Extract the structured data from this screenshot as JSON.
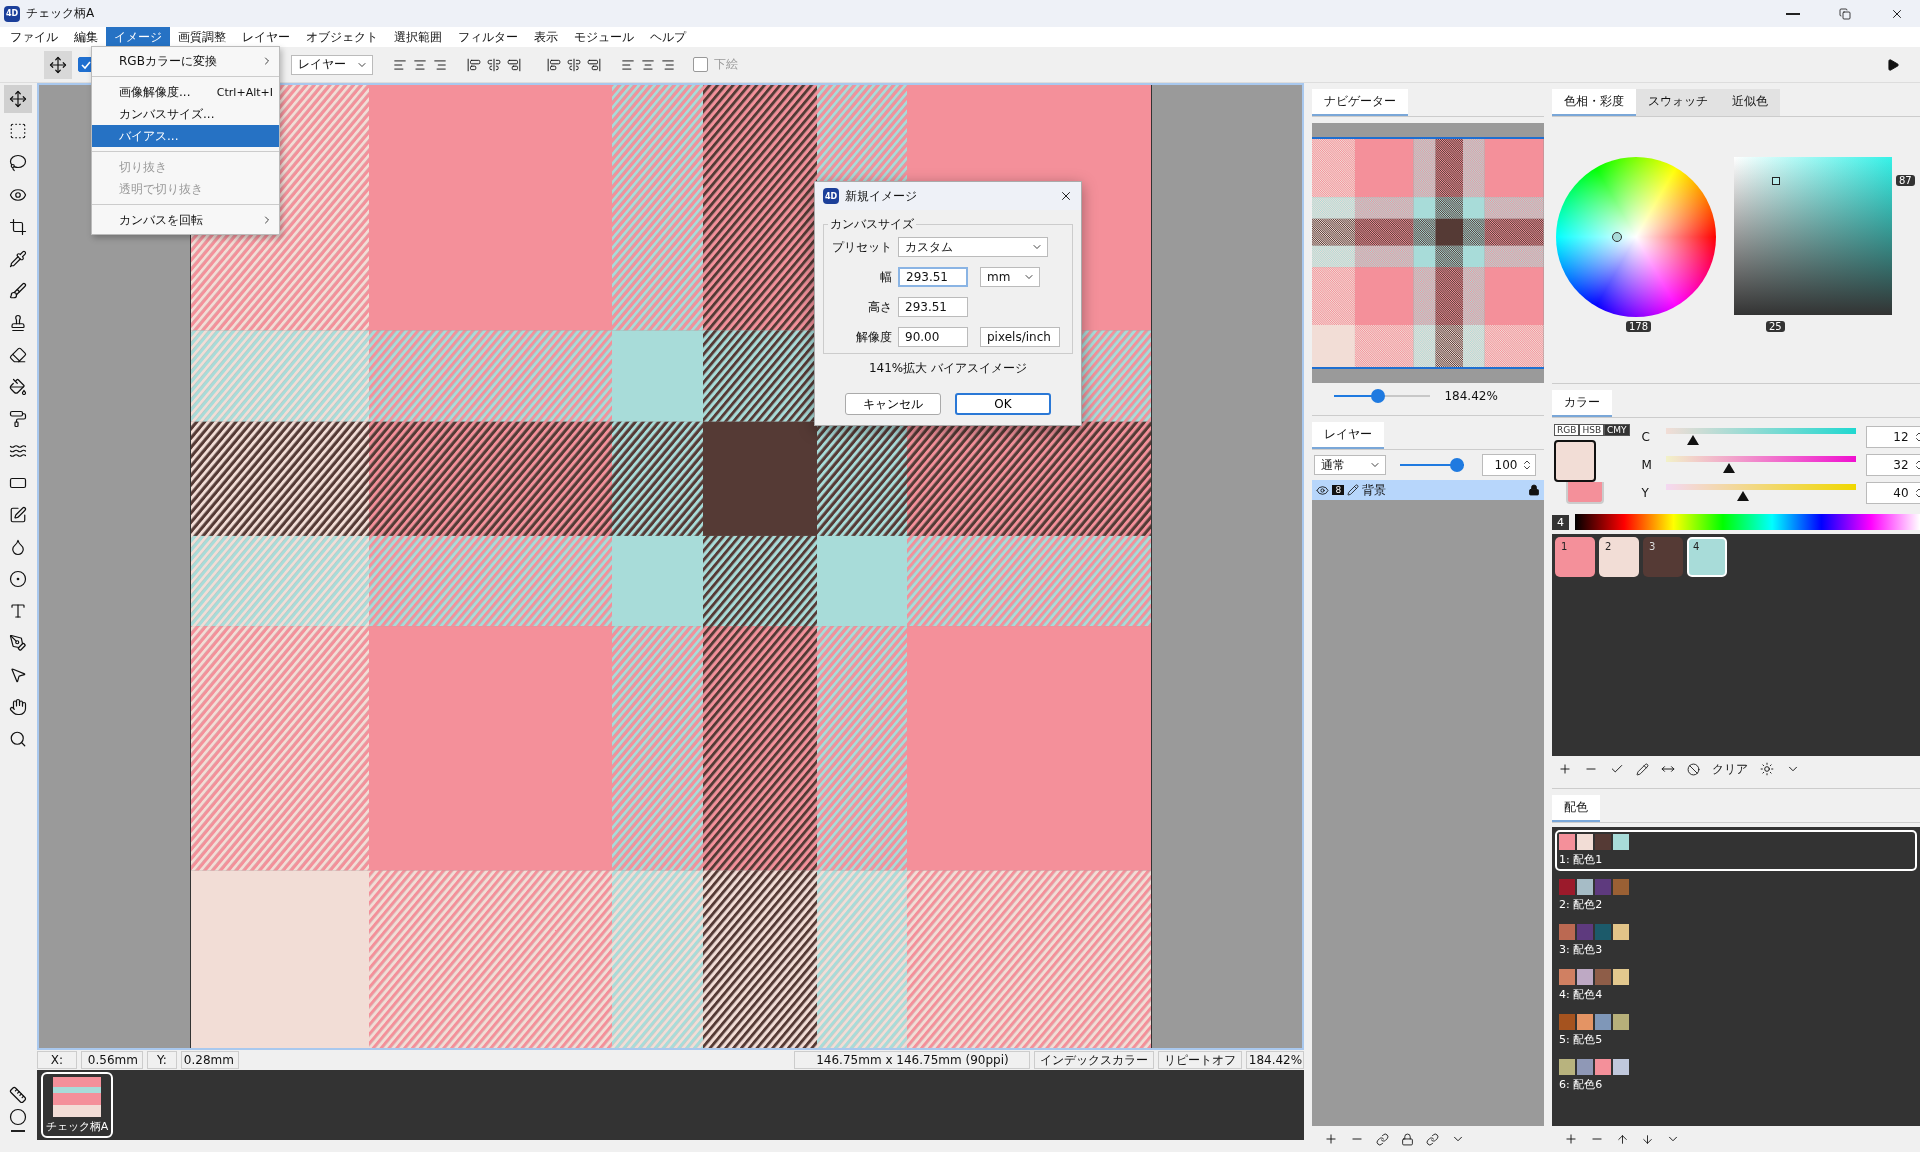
{
  "window": {
    "icon_label": "4D",
    "title": "チェック柄A"
  },
  "menu": [
    {
      "label": "ファイル",
      "selected": false
    },
    {
      "label": "編集",
      "selected": false
    },
    {
      "label": "イメージ",
      "selected": true
    },
    {
      "label": "画質調整",
      "selected": false
    },
    {
      "label": "レイヤー",
      "selected": false
    },
    {
      "label": "オブジェクト",
      "selected": false
    },
    {
      "label": "選択範囲",
      "selected": false
    },
    {
      "label": "フィルター",
      "selected": false
    },
    {
      "label": "表示",
      "selected": false
    },
    {
      "label": "モジュール",
      "selected": false
    },
    {
      "label": "ヘルプ",
      "selected": false
    }
  ],
  "toolbar": {
    "snap_checked": true,
    "target": "レイヤー",
    "underlay": {
      "label": "下絵",
      "checked": false
    }
  },
  "image_menu": [
    {
      "kind": "item",
      "label": "RGBカラーに変換",
      "submenu": true,
      "selected": false,
      "disabled": false
    },
    {
      "kind": "separator"
    },
    {
      "kind": "item",
      "label": "画像解像度...",
      "shortcut": "Ctrl+Alt+I",
      "submenu": false,
      "selected": false,
      "disabled": false
    },
    {
      "kind": "item",
      "label": "カンバスサイズ...",
      "submenu": false,
      "selected": false,
      "disabled": false
    },
    {
      "kind": "item",
      "label": "バイアス...",
      "submenu": false,
      "selected": true,
      "disabled": false
    },
    {
      "kind": "separator"
    },
    {
      "kind": "item",
      "label": "切り抜き",
      "submenu": false,
      "selected": false,
      "disabled": true
    },
    {
      "kind": "item",
      "label": "透明で切り抜き",
      "submenu": false,
      "selected": false,
      "disabled": true
    },
    {
      "kind": "separator"
    },
    {
      "kind": "item",
      "label": "カンバスを回転",
      "submenu": true,
      "selected": false,
      "disabled": false
    }
  ],
  "tools": [
    {
      "selected": true
    },
    {
      "selected": false
    },
    {
      "selected": false
    },
    {
      "selected": false
    },
    {
      "selected": false
    },
    {
      "selected": false
    },
    {
      "selected": false
    },
    {
      "selected": false
    },
    {
      "selected": false
    },
    {
      "selected": false
    },
    {
      "selected": false
    },
    {
      "selected": false
    },
    {
      "selected": false
    },
    {
      "selected": false
    },
    {
      "selected": false
    },
    {
      "selected": false
    },
    {
      "selected": false
    },
    {
      "selected": false
    },
    {
      "selected": false
    },
    {
      "selected": false
    },
    {
      "selected": false
    }
  ],
  "dialog": {
    "icon_label": "4D",
    "title": "新規イメージ",
    "group": "カンバスサイズ",
    "fields": [
      {
        "kind": "select",
        "label": "プリセット",
        "value": "カスタム"
      },
      {
        "kind": "input",
        "label": "幅",
        "value": "293.51",
        "focused": true,
        "unit": "mm"
      },
      {
        "kind": "input",
        "label": "高さ",
        "value": "293.51",
        "focused": false
      },
      {
        "kind": "input",
        "label": "解像度",
        "value": "90.00",
        "focused": false,
        "unit": "pixels/inch"
      }
    ],
    "note": "141%拡大 バイアスイメージ",
    "buttons": [
      {
        "label": "キャンセル",
        "default": false
      },
      {
        "label": "OK",
        "default": true
      }
    ]
  },
  "status_bar": {
    "x_label": "X:",
    "x": "0.56mm",
    "y_label": "Y:",
    "y": "0.28mm",
    "size": "146.75mm x 146.75mm (90ppi)",
    "color_mode": "インデックスカラー",
    "repeat": "リピートオフ",
    "zoom": "184.42%"
  },
  "documents": [
    {
      "name": "チェック柄A",
      "selected": true
    }
  ],
  "navigator": {
    "tab": "ナビゲーター",
    "level": 0.45,
    "reading": "184.42%"
  },
  "layers": {
    "tab": "レイヤー",
    "blend": "通常",
    "level": 1,
    "opacity": "100",
    "items": [
      {
        "name": "背景",
        "bit_depth": "8",
        "visible": true,
        "locked": true,
        "selected": true
      }
    ]
  },
  "picker": {
    "tabs": [
      {
        "label": "色相・彩度",
        "selected": true
      },
      {
        "label": "スウォッチ",
        "selected": false
      },
      {
        "label": "近似色",
        "selected": false
      }
    ],
    "hue_reading": "178",
    "value_reading": "87",
    "saturation_reading": "25"
  },
  "color": {
    "tab": "カラー",
    "modes": [
      {
        "label": "RGB",
        "selected": false
      },
      {
        "label": "HSB",
        "selected": false
      },
      {
        "label": "CMY",
        "selected": true
      }
    ],
    "channels": [
      {
        "label": "C",
        "level": 0.12,
        "value": "12"
      },
      {
        "label": "M",
        "level": 0.32,
        "value": "32"
      },
      {
        "label": "Y",
        "level": 0.4,
        "value": "40"
      }
    ],
    "spectrum_index": "4",
    "swatches": [
      {
        "label": "1",
        "color": "#f4909a",
        "selected": false
      },
      {
        "label": "2",
        "color": "#f2ddd6",
        "selected": false
      },
      {
        "label": "3",
        "color": "#553a35",
        "selected": false
      },
      {
        "label": "4",
        "color": "#a8dcd9",
        "selected": true
      }
    ],
    "clear": "クリア"
  },
  "schemes": {
    "tab": "配色",
    "items": [
      {
        "name": "1: 配色1",
        "selected": true,
        "swatches": [
          {
            "color": "#f4909a"
          },
          {
            "color": "#f2ddd6"
          },
          {
            "color": "#553a35"
          },
          {
            "color": "#a8dcd9"
          }
        ]
      },
      {
        "name": "2: 配色2",
        "selected": false,
        "swatches": [
          {
            "color": "#9b1a2b"
          },
          {
            "color": "#a6bcc6"
          },
          {
            "color": "#5e3a7e"
          },
          {
            "color": "#9a6034"
          }
        ]
      },
      {
        "name": "3: 配色3",
        "selected": false,
        "swatches": [
          {
            "color": "#bb6952"
          },
          {
            "color": "#5e3a7e"
          },
          {
            "color": "#1c5a6a"
          },
          {
            "color": "#e2c488"
          }
        ]
      },
      {
        "name": "4: 配色4",
        "selected": false,
        "swatches": [
          {
            "color": "#d08062"
          },
          {
            "color": "#bea9c4"
          },
          {
            "color": "#8e5d48"
          },
          {
            "color": "#e2c88e"
          }
        ]
      },
      {
        "name": "5: 配色5",
        "selected": false,
        "swatches": [
          {
            "color": "#a5531f"
          },
          {
            "color": "#e49464"
          },
          {
            "color": "#7f97b8"
          },
          {
            "color": "#b7b07a"
          }
        ]
      },
      {
        "name": "6: 配色6",
        "selected": false,
        "swatches": [
          {
            "color": "#b8b37e"
          },
          {
            "color": "#8f98b6"
          },
          {
            "color": "#f4909a"
          },
          {
            "color": "#c0c8dc"
          }
        ]
      }
    ]
  }
}
